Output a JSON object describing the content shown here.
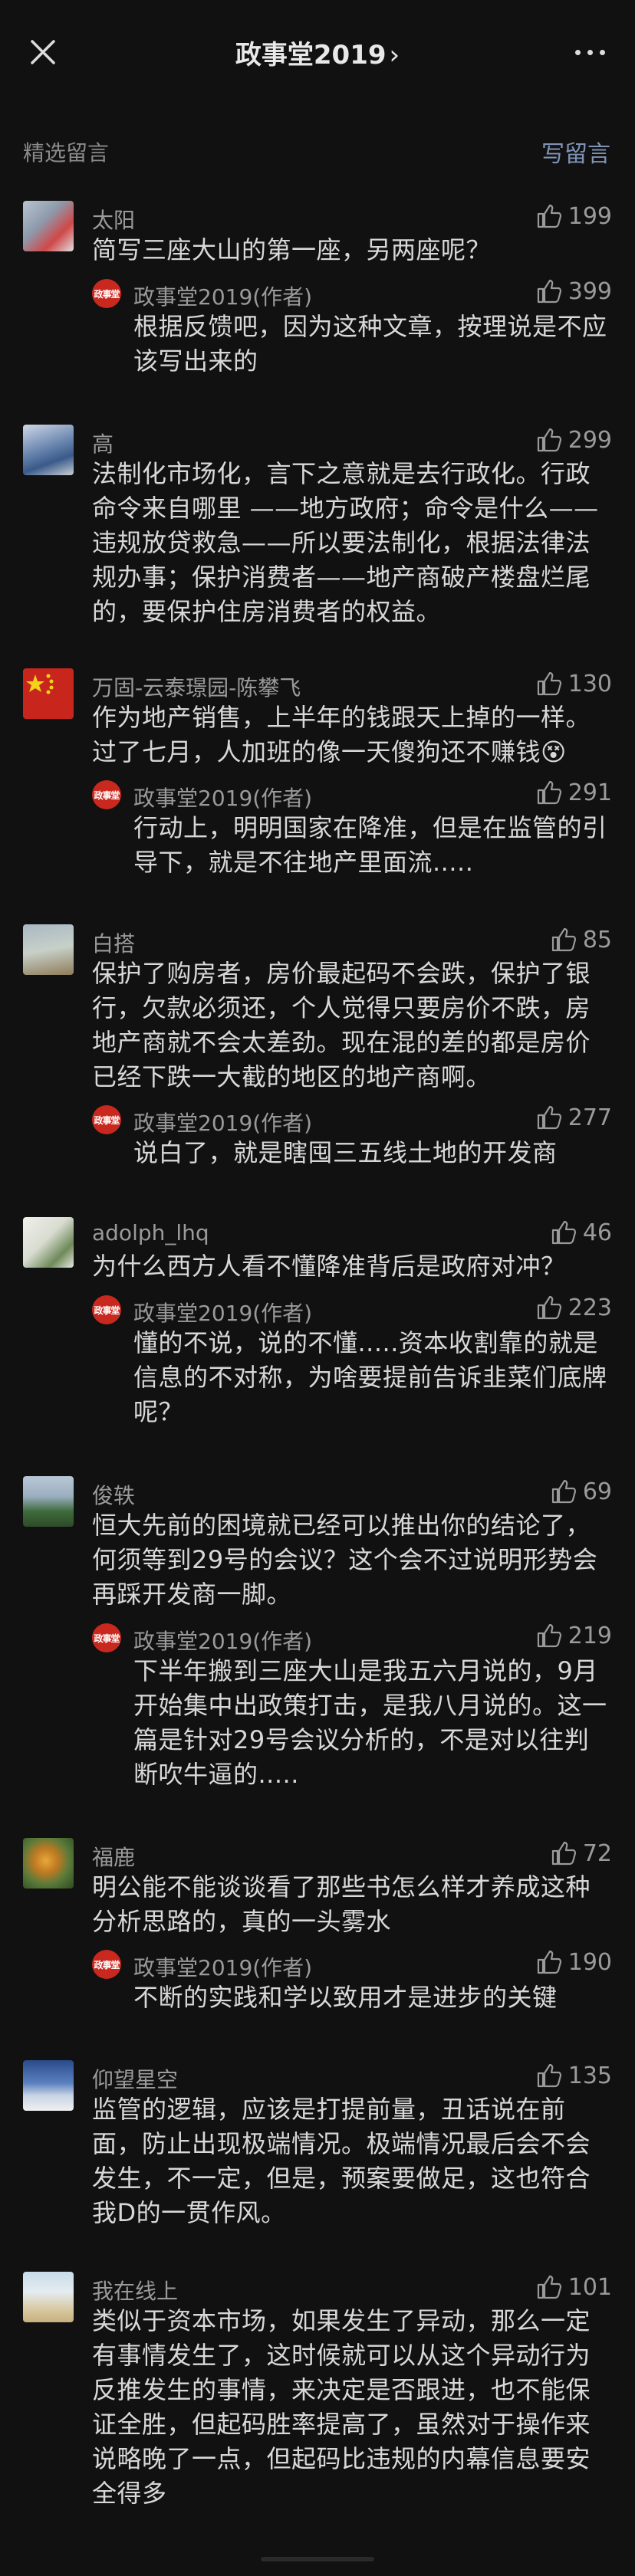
{
  "header": {
    "title": "政事堂2019",
    "chevron": "›"
  },
  "section": {
    "title": "精选留言",
    "write_label": "写留言"
  },
  "author_badge": "政事堂",
  "comments": [
    {
      "name": "太阳",
      "likes": "199",
      "text": "简写三座大山的第一座，另两座呢？",
      "reply": {
        "name": "政事堂2019(作者)",
        "likes": "399",
        "text": "根据反馈吧，因为这种文章，按理说是不应该写出来的"
      }
    },
    {
      "name": "高",
      "likes": "299",
      "text": "法制化市场化，言下之意就是去行政化。行政命令来自哪里 ——地方政府；命令是什么——违规放贷救急——所以要法制化，根据法律法规办事；保护消费者——地产商破产楼盘烂尾的，要保护住房消费者的权益。"
    },
    {
      "name": "万固-云泰璟园-陈攀飞",
      "likes": "130",
      "text": "作为地产销售，上半年的钱跟天上掉的一样。过了七月，人加班的像一天傻狗还不赚钱😵",
      "reply": {
        "name": "政事堂2019(作者)",
        "likes": "291",
        "text": "行动上，明明国家在降准，但是在监管的引导下，就是不往地产里面流....."
      }
    },
    {
      "name": "白搭",
      "likes": "85",
      "text": "保护了购房者，房价最起码不会跌，保护了银行，欠款必须还，个人觉得只要房价不跌，房地产商就不会太差劲。现在混的差的都是房价已经下跌一大截的地区的地产商啊。",
      "reply": {
        "name": "政事堂2019(作者)",
        "likes": "277",
        "text": "说白了，就是瞎囤三五线土地的开发商"
      }
    },
    {
      "name": "adolph_lhq",
      "likes": "46",
      "text": "为什么西方人看不懂降准背后是政府对冲？",
      "reply": {
        "name": "政事堂2019(作者)",
        "likes": "223",
        "text": "懂的不说，说的不懂.....资本收割靠的就是信息的不对称，为啥要提前告诉韭菜们底牌呢？"
      }
    },
    {
      "name": "俊轶",
      "likes": "69",
      "text": "恒大先前的困境就已经可以推出你的结论了，何须等到29号的会议？这个会不过说明形势会再踩开发商一脚。",
      "reply": {
        "name": "政事堂2019(作者)",
        "likes": "219",
        "text": "下半年搬到三座大山是我五六月说的，9月开始集中出政策打击，是我八月说的。这一篇是针对29号会议分析的，不是对以往判断吹牛逼的....."
      }
    },
    {
      "name": "福鹿",
      "likes": "72",
      "text": "明公能不能谈谈看了那些书怎么样才养成这种分析思路的，真的一头雾水",
      "reply": {
        "name": "政事堂2019(作者)",
        "likes": "190",
        "text": "不断的实践和学以致用才是进步的关键"
      }
    },
    {
      "name": "仰望星空",
      "likes": "135",
      "text": "监管的逻辑，应该是打提前量，丑话说在前面，防止出现极端情况。极端情况最后会不会发生，不一定，但是，预案要做足，这也符合我D的一贯作风。"
    },
    {
      "name": "我在线上",
      "likes": "101",
      "text": "类似于资本市场，如果发生了异动，那么一定有事情发生了，这时候就可以从这个异动行为反推发生的事情，来决定是否跟进，也不能保证全胜，但起码胜率提高了，虽然对于操作来说略晚了一点，但起码比违规的内幕信息要安全得多"
    }
  ]
}
